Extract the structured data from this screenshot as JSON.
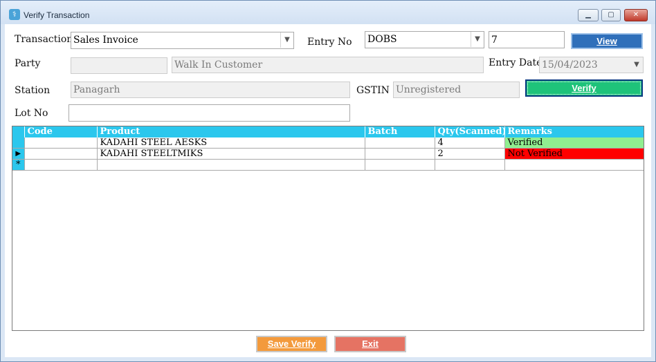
{
  "window": {
    "title": "Verify Transaction"
  },
  "form": {
    "transaction_label": "Transaction",
    "transaction_value": "Sales Invoice",
    "entry_no_label": "Entry No",
    "entry_series": "DOBS",
    "entry_no_value": "7",
    "view_label": "View",
    "party_label": "Party",
    "party_code": "",
    "party_name": "Walk In Customer",
    "entry_date_label": "Entry Date",
    "entry_date_value": "15/04/2023",
    "station_label": "Station",
    "station_value": "Panagarh",
    "gstin_label": "GSTIN",
    "gstin_value": "Unregistered",
    "verify_label": "Verify",
    "lot_no_label": "Lot No",
    "lot_no_value": ""
  },
  "grid": {
    "columns": [
      "Code",
      "Product",
      "Batch",
      "Qty(Scanned)",
      "Remarks"
    ],
    "rows": [
      {
        "code": "",
        "product": "KADAHI STEEL AESKS",
        "batch": "",
        "qty": "4",
        "remarks": "Verified"
      },
      {
        "code": "",
        "product": "KADAHI STEELTMIKS",
        "batch": "",
        "qty": "2",
        "remarks": "Not Verified"
      }
    ]
  },
  "footer": {
    "save_label": "Save Verify",
    "exit_label": "Exit"
  },
  "colors": {
    "verified": "#90ee90",
    "not_verified": "#ff0000",
    "grid_header": "#2bc7ed",
    "view_button": "#2f6fba",
    "verify_button": "#1ec37a",
    "save_button": "#f39a3c",
    "exit_button": "#e57363"
  }
}
